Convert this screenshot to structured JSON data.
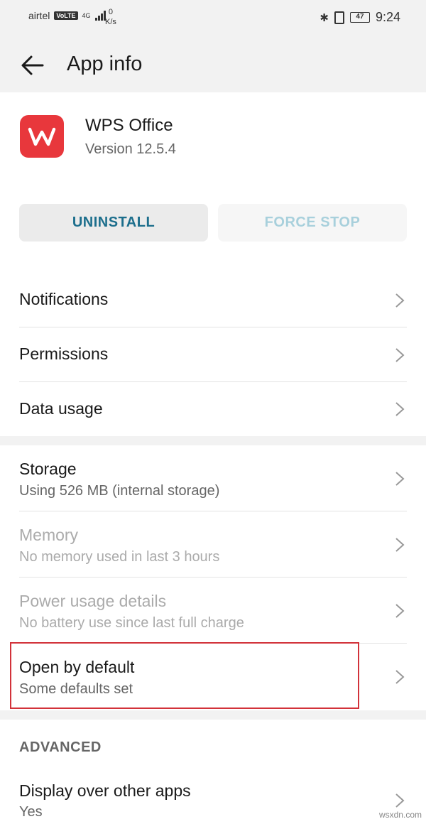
{
  "status_bar": {
    "carrier": "airtel",
    "volte": "VoLTE",
    "network": "4G",
    "speed_value": "0",
    "speed_unit": "K/s",
    "battery": "47",
    "time": "9:24"
  },
  "app_bar": {
    "title": "App info"
  },
  "app": {
    "name": "WPS Office",
    "version": "Version 12.5.4",
    "icon_color": "#e8373c"
  },
  "buttons": {
    "uninstall": "UNINSTALL",
    "force_stop": "FORCE STOP"
  },
  "group1": [
    {
      "title": "Notifications"
    },
    {
      "title": "Permissions"
    },
    {
      "title": "Data usage"
    }
  ],
  "group2": [
    {
      "title": "Storage",
      "subtitle": "Using 526 MB (internal storage)"
    },
    {
      "title": "Memory",
      "subtitle": "No memory used in last 3 hours"
    },
    {
      "title": "Power usage details",
      "subtitle": "No battery use since last full charge"
    },
    {
      "title": "Open by default",
      "subtitle": "Some defaults set"
    }
  ],
  "advanced": {
    "label": "ADVANCED",
    "items": [
      {
        "title": "Display over other apps",
        "subtitle": "Yes"
      }
    ]
  },
  "watermark": "wsxdn.com",
  "colors": {
    "accent": "#1c6e8c",
    "accent_disabled": "#a8d0dc",
    "highlight": "#d2323a"
  }
}
